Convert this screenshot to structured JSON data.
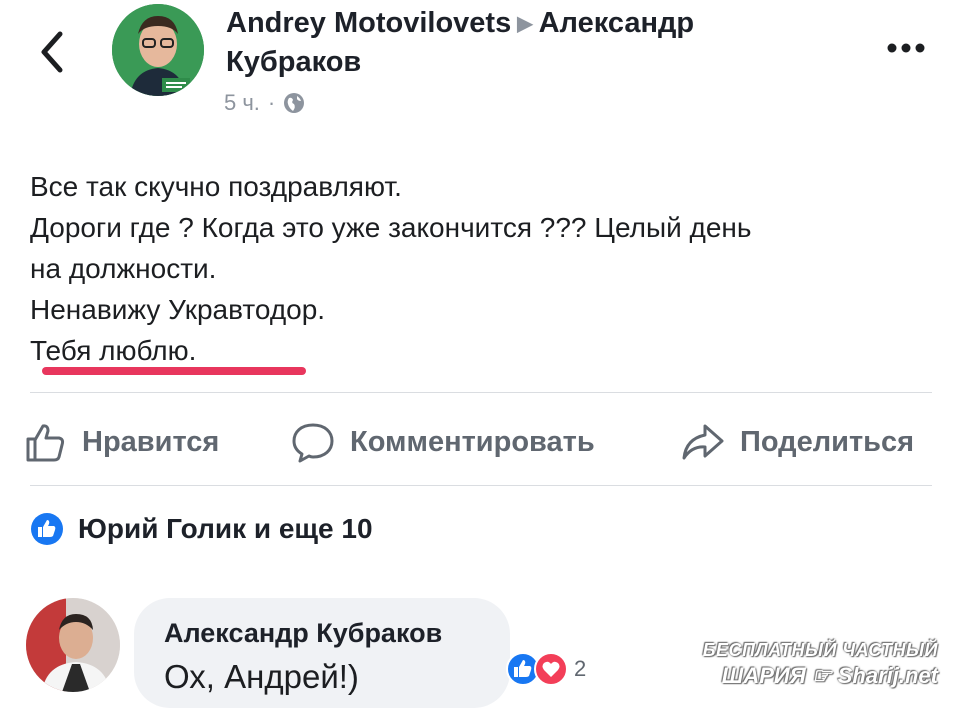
{
  "header": {
    "author": "Andrey Motovilovets",
    "recipient": "Александр",
    "recipient_line2": "Кубраков",
    "time": "5 ч.",
    "dot": "·",
    "privacy_icon": "globe-icon"
  },
  "post": {
    "lines": [
      "Все так скучно поздравляют.",
      "Дороги где ? Когда это уже закончится ??? Целый день",
      "на должности.",
      "Ненавижу Укравтодор.",
      "Тебя люблю."
    ],
    "highlight_color": "#e8365d"
  },
  "actions": {
    "like": "Нравится",
    "comment": "Комментировать",
    "share": "Поделиться"
  },
  "likes_summary": {
    "text": "Юрий Голик и еще 10"
  },
  "comment": {
    "author": "Александр Кубраков",
    "text": "Ох, Андрей!)",
    "reaction_count": "2"
  },
  "watermark": {
    "line1": "БЕСПЛАТНЫЙ ЧАСТНЫЙ",
    "line2": "ШАРИЯ",
    "site": "Sharij.net"
  },
  "colors": {
    "like_blue": "#1877f2",
    "love_red": "#f33e58",
    "text_grey": "#606770"
  }
}
